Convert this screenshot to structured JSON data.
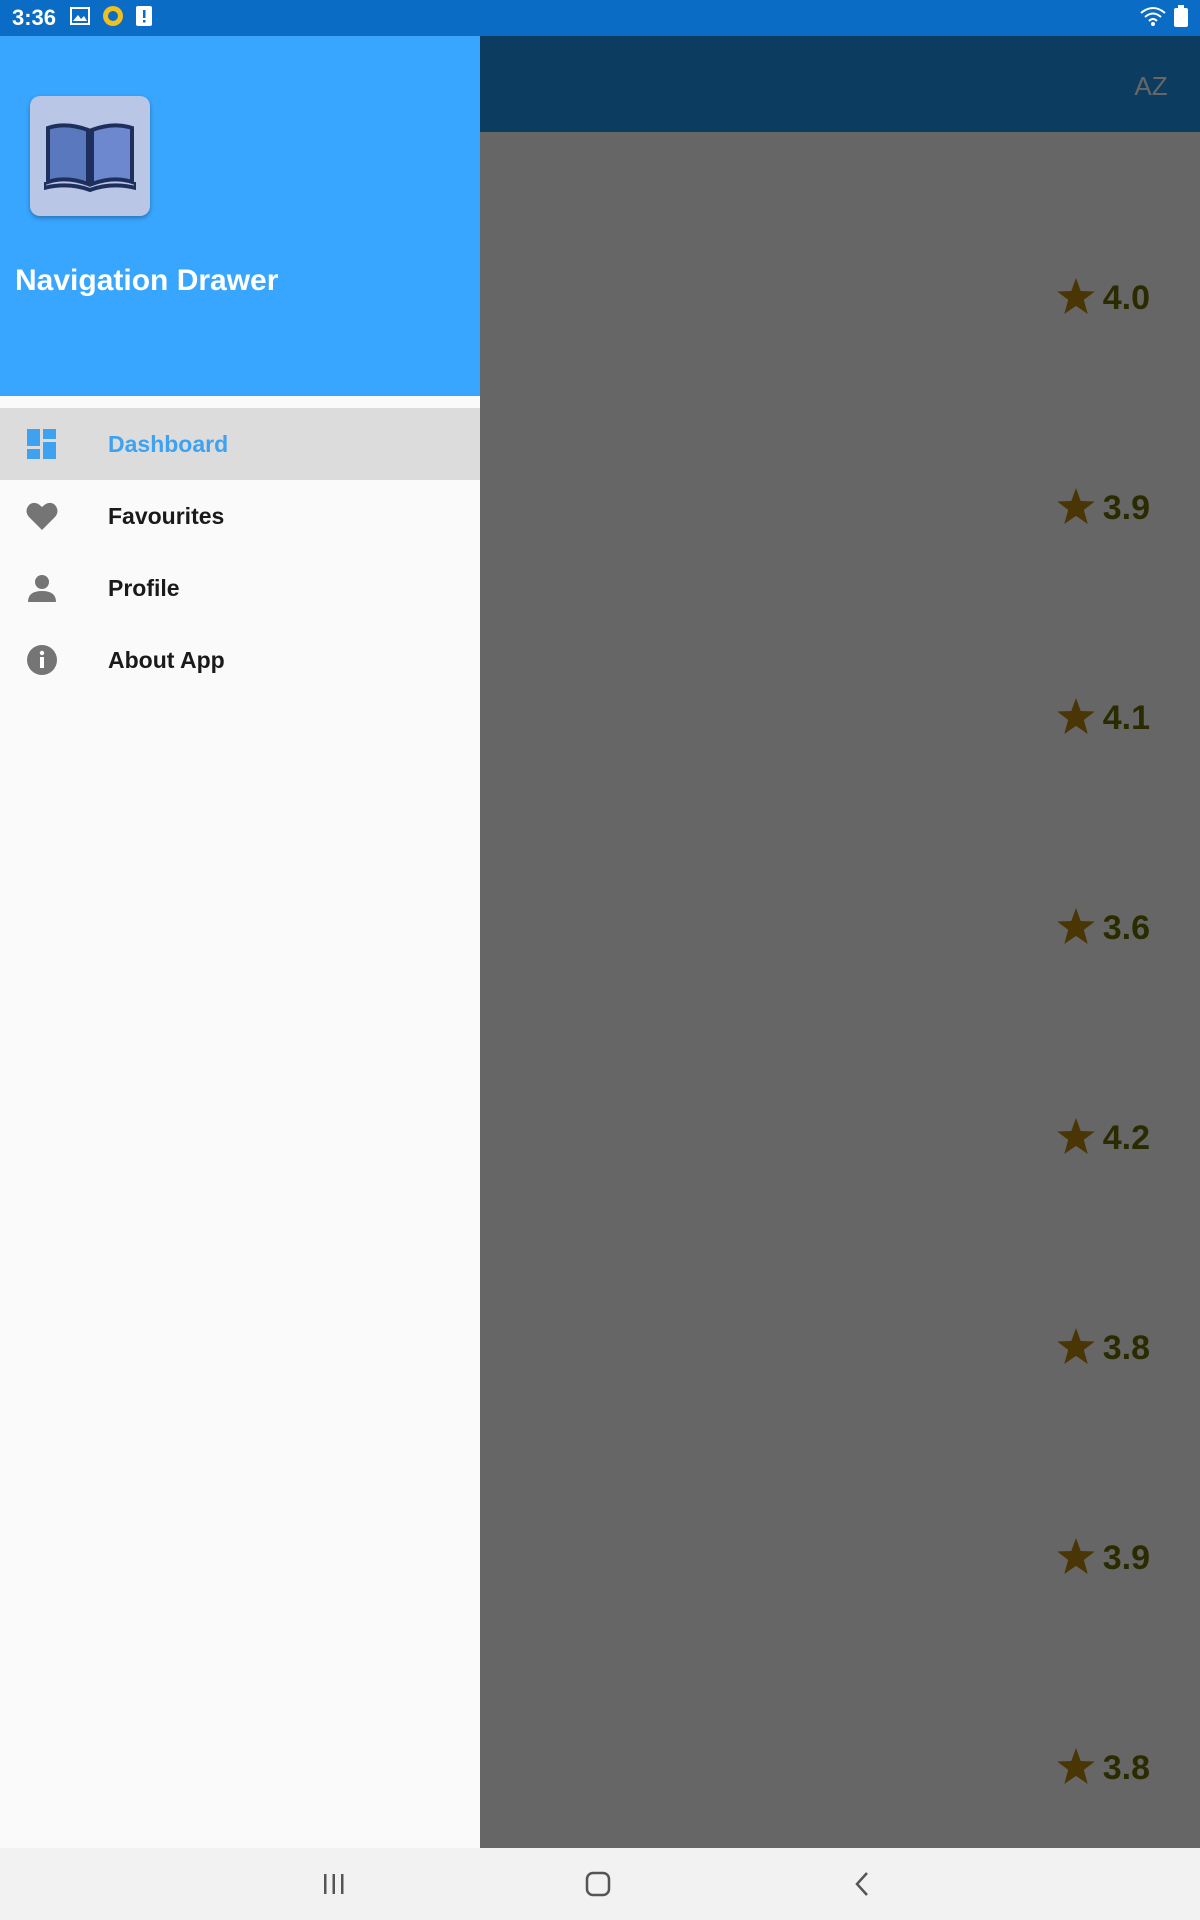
{
  "status_bar": {
    "time": "3:36",
    "left_icons": [
      "image-icon",
      "record-icon",
      "alert-icon"
    ],
    "right_icons": [
      "wifi-icon",
      "battery-icon"
    ]
  },
  "app_bar": {
    "sort_label": "AZ",
    "color": "#2196f3"
  },
  "books": [
    {
      "rating": "4.0"
    },
    {
      "rating": "3.9"
    },
    {
      "rating": "4.1"
    },
    {
      "rating": "3.6"
    },
    {
      "rating": "4.2"
    },
    {
      "rating": "3.8"
    },
    {
      "rating": "3.9"
    },
    {
      "rating": "3.8"
    }
  ],
  "drawer": {
    "title": "Navigation Drawer",
    "header_color": "#38a6ff",
    "items": [
      {
        "label": "Dashboard",
        "icon": "dashboard-icon",
        "selected": true
      },
      {
        "label": "Favourites",
        "icon": "heart-icon",
        "selected": false
      },
      {
        "label": "Profile",
        "icon": "person-icon",
        "selected": false
      },
      {
        "label": "About App",
        "icon": "info-icon",
        "selected": false
      }
    ]
  },
  "system_nav": {
    "buttons": [
      "recent-apps-icon",
      "home-icon",
      "back-icon"
    ]
  },
  "colors": {
    "accent": "#3fa2f0",
    "star": "#b8860b",
    "rating_text": "#6b6b00"
  }
}
